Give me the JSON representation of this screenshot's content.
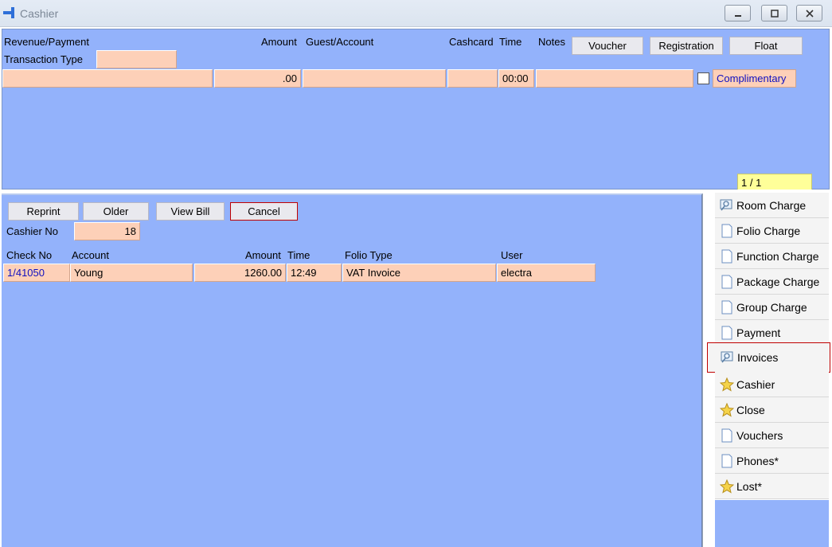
{
  "window": {
    "title": "Cashier"
  },
  "top": {
    "headers": {
      "revenue_payment": "Revenue/Payment",
      "amount": "Amount",
      "guest_account": "Guest/Account",
      "cashcard": "Cashcard",
      "time": "Time",
      "notes": "Notes"
    },
    "transaction_type_label": "Transaction Type",
    "transaction_type_value": "",
    "buttons": {
      "voucher": "Voucher",
      "registration": "Registration",
      "float": "Float"
    },
    "row": {
      "revenue": "",
      "amount": ".00",
      "guest": "",
      "cashcard": "",
      "time": "00:00",
      "notes": ""
    },
    "complimentary": {
      "label": "Complimentary",
      "checked": false
    },
    "pager": "1 / 1"
  },
  "bottom": {
    "buttons": {
      "reprint": "Reprint",
      "older": "Older",
      "view_bill": "View Bill",
      "cancel": "Cancel"
    },
    "cashier_no_label": "Cashier No",
    "cashier_no_value": "18",
    "columns": [
      "Check No",
      "Account",
      "Amount",
      "Time",
      "Folio Type",
      "User"
    ],
    "rows": [
      {
        "check_no": "1/41050",
        "account": "Young",
        "amount": "1260.00",
        "time": "12:49",
        "folio_type": "VAT Invoice",
        "user": "electra"
      }
    ]
  },
  "sidebar": {
    "items": [
      {
        "label": "Room Charge",
        "icon": "search-doc-icon"
      },
      {
        "label": "Folio Charge",
        "icon": "document-icon"
      },
      {
        "label": "Function Charge",
        "icon": "document-icon"
      },
      {
        "label": "Package Charge",
        "icon": "document-icon"
      },
      {
        "label": "Group Charge",
        "icon": "document-icon"
      },
      {
        "label": "Payment",
        "icon": "document-icon"
      },
      {
        "label": "Invoices",
        "icon": "search-doc-icon",
        "highlighted": true
      },
      {
        "label": "Cashier",
        "icon": "star-icon"
      },
      {
        "label": "Close",
        "icon": "star-icon"
      },
      {
        "label": "Vouchers",
        "icon": "document-icon"
      },
      {
        "label": "Phones*",
        "icon": "document-icon"
      },
      {
        "label": "Lost*",
        "icon": "star-icon"
      }
    ]
  },
  "colors": {
    "panel": "#93b2fb",
    "field": "#fdd0b8",
    "highlight": "#c00000",
    "pager": "#ffff99"
  }
}
